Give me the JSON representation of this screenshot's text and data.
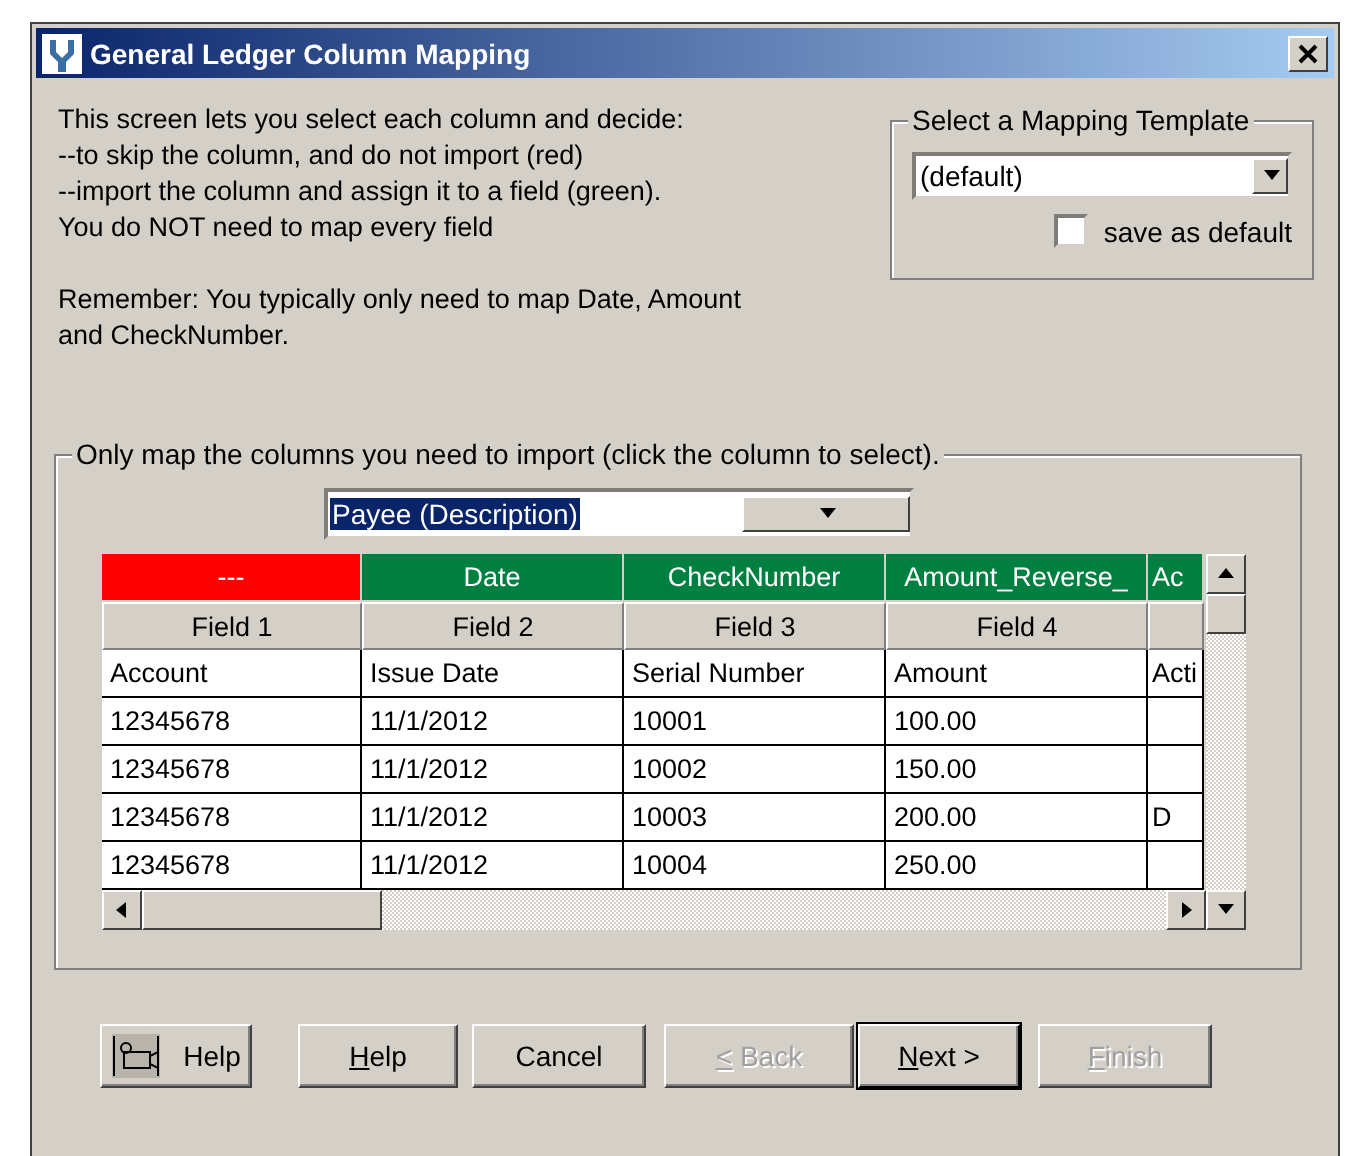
{
  "window": {
    "title": "General Ledger Column Mapping"
  },
  "instructions": [
    "This screen lets you select each column and decide:",
    "--to skip the column, and do not import (red)",
    "--import the column and assign it to a field (green).",
    "You do NOT need to map every field"
  ],
  "reminder": [
    "Remember:  You typically only need to map Date, Amount",
    "and CheckNumber."
  ],
  "template": {
    "legend": "Select a Mapping Template",
    "value": "(default)",
    "save_default": {
      "label": "save as default",
      "checked": false
    }
  },
  "mapping": {
    "legend": "Only map the columns you need to import (click the column to select).",
    "field_value": "Payee (Description)",
    "columns": [
      {
        "mapping": "---",
        "color": "#ff0000",
        "field": "Field 1"
      },
      {
        "mapping": "Date",
        "color": "#008040",
        "field": "Field 2"
      },
      {
        "mapping": "CheckNumber",
        "color": "#008040",
        "field": "Field 3"
      },
      {
        "mapping": "Amount_Reverse_",
        "color": "#008040",
        "field": "Field 4"
      },
      {
        "mapping": "Ac",
        "color": "#008040"
      }
    ],
    "rows": [
      [
        "Account",
        "Issue Date",
        "Serial Number",
        "Amount",
        "Acti"
      ],
      [
        "12345678",
        "11/1/2012",
        "10001",
        "100.00",
        ""
      ],
      [
        "12345678",
        "11/1/2012",
        "10002",
        "150.00",
        ""
      ],
      [
        "12345678",
        "11/1/2012",
        "10003",
        "200.00",
        "D"
      ],
      [
        "12345678",
        "11/1/2012",
        "10004",
        "250.00",
        ""
      ]
    ]
  },
  "buttons": [
    {
      "kind": "icon",
      "label": "Help",
      "disabled": false,
      "default": false,
      "underline_first": false
    },
    {
      "kind": "text",
      "label": "Help",
      "disabled": false,
      "default": false,
      "underline_first": true
    },
    {
      "kind": "text",
      "label": "Cancel",
      "disabled": false,
      "default": false,
      "underline_first": false
    },
    {
      "kind": "text",
      "label": "< Back",
      "disabled": true,
      "default": false,
      "underline_first": true
    },
    {
      "kind": "text",
      "label": "Next >",
      "disabled": false,
      "default": true,
      "underline_first": true
    },
    {
      "kind": "text",
      "label": "Finish",
      "disabled": true,
      "default": false,
      "underline_first": true
    }
  ]
}
